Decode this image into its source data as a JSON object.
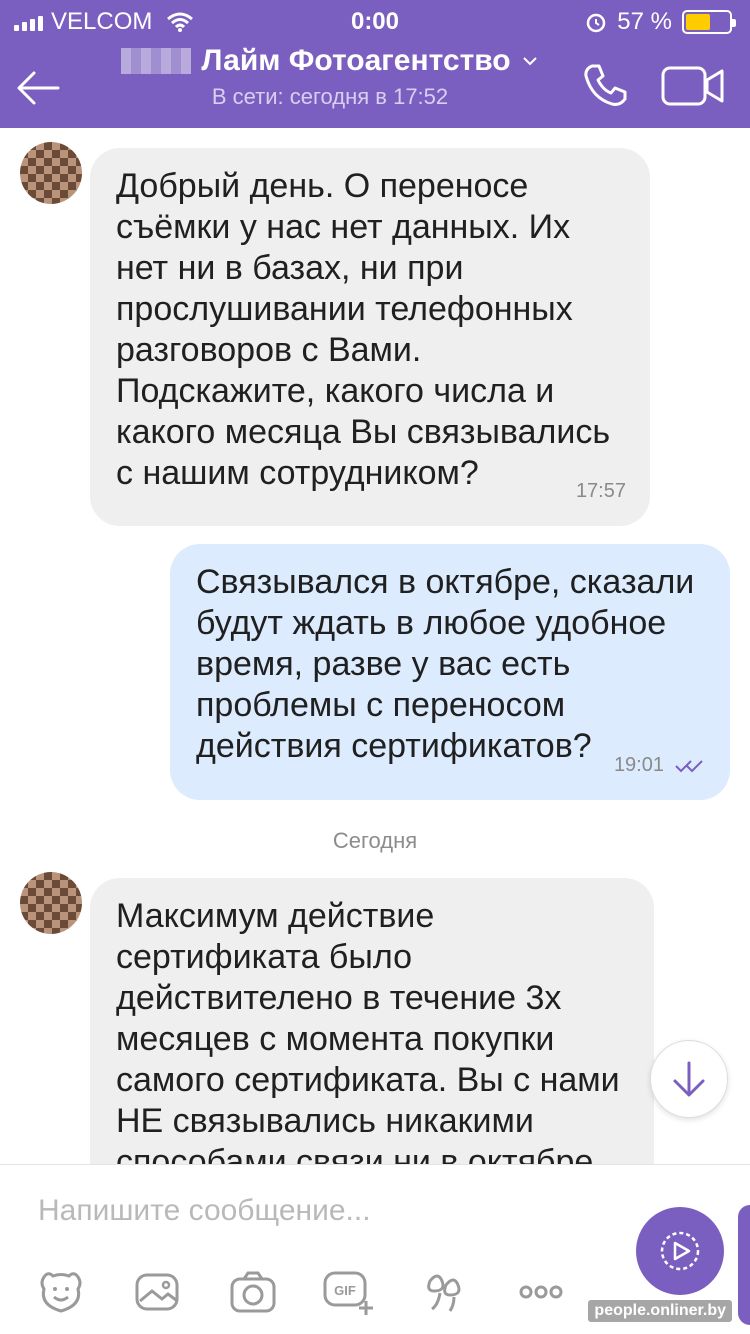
{
  "status_bar": {
    "carrier": "VELCOM",
    "time": "0:00",
    "battery_percent": "57 %",
    "battery_level": 0.57,
    "battery_color": "#ffcc00"
  },
  "header": {
    "title": "Лайм Фотоагентство",
    "subtitle": "В сети: сегодня в 17:52",
    "accent_color": "#7b5fc0",
    "icons": [
      "back-arrow-icon",
      "chevron-down-icon",
      "phone-icon",
      "video-camera-icon"
    ]
  },
  "messages": [
    {
      "direction": "incoming",
      "text": "Добрый день. О переносе\nсъёмки у нас нет данных. Их\nнет ни в базах, ни при\nпрослушивании телефонных\nразговоров с Вами.\nПодскажите, какого числа и\nкакого месяца Вы связывались\nс нашим сотрудником?",
      "time": "17:57"
    },
    {
      "direction": "outgoing",
      "text": "Связывался в октябре, сказали\nбудут ждать в любое удобное\nвремя, разве у вас есть\nпроблемы с переносом\nдействия сертификатов?",
      "time": "19:01",
      "status": "read"
    },
    {
      "direction": "incoming",
      "text": "Максимум действие\nсертификата было\nдействителено в течение 3х\nмесяцев с момента покупки\nсамого сертификата. Вы с нами\nНЕ связывались никакими\nспособами связи ни в октябре,",
      "time": ""
    }
  ],
  "day_separator": "Сегодня",
  "composer": {
    "placeholder": "Напишите сообщение...",
    "toolbar_icons": [
      "sticker-icon",
      "gallery-icon",
      "camera-icon",
      "gif-icon",
      "doodle-icon",
      "more-icon"
    ],
    "gif_label": "GIF"
  },
  "watermark": "people.onliner.by"
}
